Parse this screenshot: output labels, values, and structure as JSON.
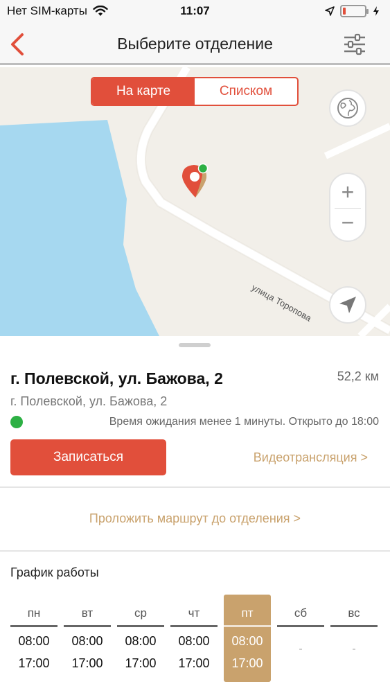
{
  "status_bar": {
    "carrier": "Нет SIM-карты",
    "time": "11:07",
    "battery_level": 0.12
  },
  "nav": {
    "title": "Выберите отделение"
  },
  "map": {
    "toggle": {
      "map_label": "На карте",
      "list_label": "Списком",
      "selected": "map"
    },
    "street_name": "улица Торопова",
    "zoom_in": "+",
    "zoom_out": "−"
  },
  "branch": {
    "title": "г. Полевской, ул. Бажова, 2",
    "distance": "52,2 км",
    "address": "г. Полевской, ул. Бажова, 2",
    "status": "Время ожидания менее 1 минуты. Открыто до 18:00",
    "book_button": "Записаться",
    "video_link": "Видеотрансляция >",
    "route_link": "Проложить маршрут до отделения >"
  },
  "schedule": {
    "title": "График работы",
    "days": [
      {
        "label": "пн",
        "open": "08:00",
        "close": "17:00",
        "today": false
      },
      {
        "label": "вт",
        "open": "08:00",
        "close": "17:00",
        "today": false
      },
      {
        "label": "ср",
        "open": "08:00",
        "close": "17:00",
        "today": false
      },
      {
        "label": "чт",
        "open": "08:00",
        "close": "17:00",
        "today": false
      },
      {
        "label": "пт",
        "open": "08:00",
        "close": "17:00",
        "today": true
      },
      {
        "label": "сб",
        "open": "",
        "close": "",
        "closed_mark": "-",
        "today": false
      },
      {
        "label": "вс",
        "open": "",
        "close": "",
        "closed_mark": "-",
        "today": false
      }
    ]
  },
  "colors": {
    "accent": "#e14f3b",
    "gold": "#c9a26d",
    "status_ok": "#2db044",
    "water": "#a6d8f0",
    "map_land": "#f2efe9"
  }
}
